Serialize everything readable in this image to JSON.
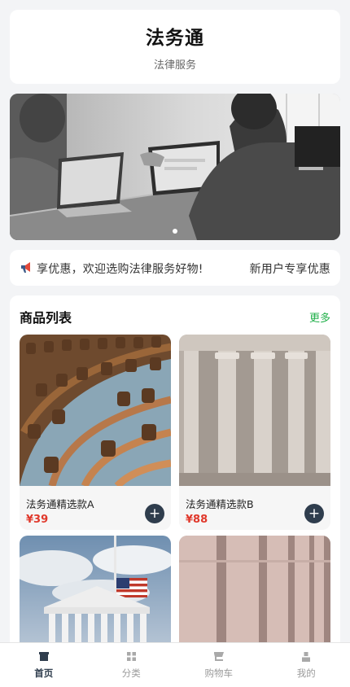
{
  "header": {
    "title": "法务通",
    "subtitle": "法律服务"
  },
  "banner": {
    "dots": 1,
    "active_dot": 0
  },
  "notice": {
    "icon": "megaphone-icon",
    "text_scrolling": "享优惠，欢迎选购法律服务好物!",
    "text_right": "新用户专享优惠"
  },
  "products": {
    "title": "商品列表",
    "more_label": "更多",
    "items": [
      {
        "name": "法务通精选款A",
        "price": "¥39",
        "image": "parliament-chamber"
      },
      {
        "name": "法务通精选款B",
        "price": "¥88",
        "image": "stone-columns"
      },
      {
        "name": "",
        "price": "",
        "image": "supreme-court-flag"
      },
      {
        "name": "",
        "price": "",
        "image": "pink-columns"
      }
    ],
    "add_icon": "+"
  },
  "tabbar": {
    "items": [
      {
        "label": "首页",
        "icon": "shop-icon",
        "active": true
      },
      {
        "label": "分类",
        "icon": "grid-icon",
        "active": false
      },
      {
        "label": "购物车",
        "icon": "cart-icon",
        "active": false
      },
      {
        "label": "我的",
        "icon": "user-icon",
        "active": false
      }
    ]
  },
  "colors": {
    "accent": "#2f3d4d",
    "price": "#e0382b",
    "more": "#22b04b"
  }
}
